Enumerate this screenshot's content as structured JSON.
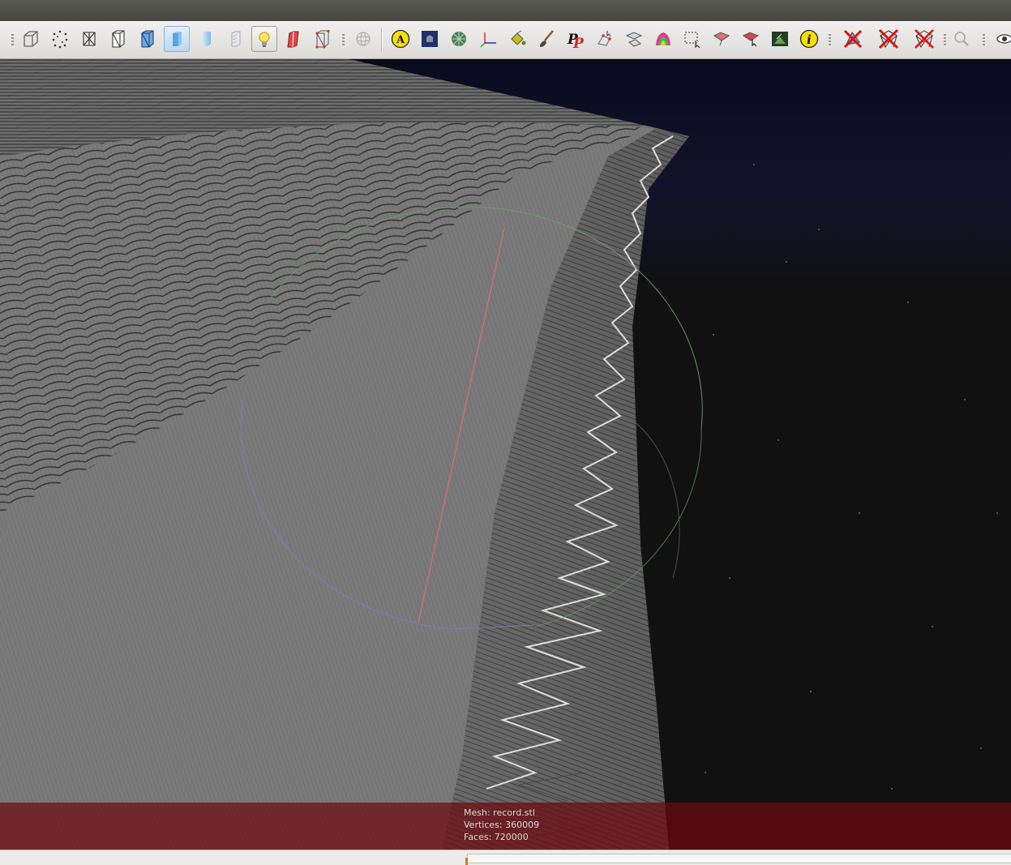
{
  "app": {
    "window_title": ""
  },
  "toolbar": {
    "buttons": [
      {
        "icon": "bbox-box-icon",
        "active": false
      },
      {
        "icon": "points-view-icon",
        "active": false
      },
      {
        "icon": "wireframe-view-icon",
        "active": false
      },
      {
        "icon": "hidden-lines-view-icon",
        "active": false
      },
      {
        "icon": "flat-lines-view-icon",
        "active": false
      },
      {
        "icon": "flat-shading-icon",
        "active": true
      },
      {
        "icon": "smooth-shading-icon",
        "active": false
      },
      {
        "icon": "texture-view-icon",
        "active": false
      },
      {
        "icon": "light-bulb-icon",
        "active": true
      },
      {
        "icon": "backface-icon",
        "active": false
      },
      {
        "icon": "selected-faces-icon",
        "active": false
      },
      {
        "icon": "trackball-icon",
        "active": false
      },
      {
        "icon": "annotation-a-icon",
        "active": false
      },
      {
        "icon": "raster-layer-icon",
        "active": false
      },
      {
        "icon": "decorate-mesh-icon",
        "active": false
      },
      {
        "icon": "axis-icon",
        "active": false
      },
      {
        "icon": "paint-bucket-icon",
        "active": false
      },
      {
        "icon": "paintbrush-icon",
        "active": false
      },
      {
        "icon": "pickpoints-icon",
        "active": false
      },
      {
        "icon": "select-vertices-icon",
        "active": false
      },
      {
        "icon": "align-tool-icon",
        "active": false
      },
      {
        "icon": "color-mesh-icon",
        "active": false
      },
      {
        "icon": "select-region-icon",
        "active": false
      },
      {
        "icon": "select-faces-icon",
        "active": false
      },
      {
        "icon": "select-connected-icon",
        "active": false
      },
      {
        "icon": "render-image-icon",
        "active": false
      },
      {
        "icon": "info-icon",
        "active": false
      },
      {
        "icon": "delete-vertices-icon",
        "active": false
      },
      {
        "icon": "delete-faces-icon",
        "active": false
      },
      {
        "icon": "delete-faces-vertices-icon",
        "active": false
      },
      {
        "icon": "search-icon",
        "active": false
      },
      {
        "icon": "eye-icon",
        "active": false
      }
    ]
  },
  "info_panel": {
    "mesh_label": "Mesh: record.stl",
    "vertices_label": "Vertices: 360009",
    "faces_label": "Faces: 720000"
  },
  "colors": {
    "info_overlay": "#6e0a0e",
    "mesh_surface": "#7a7a7a",
    "background": "#111111",
    "trackball_green": "#6f9b6f",
    "trackball_red": "#d07070",
    "trackball_blue": "#7a7ac8"
  }
}
